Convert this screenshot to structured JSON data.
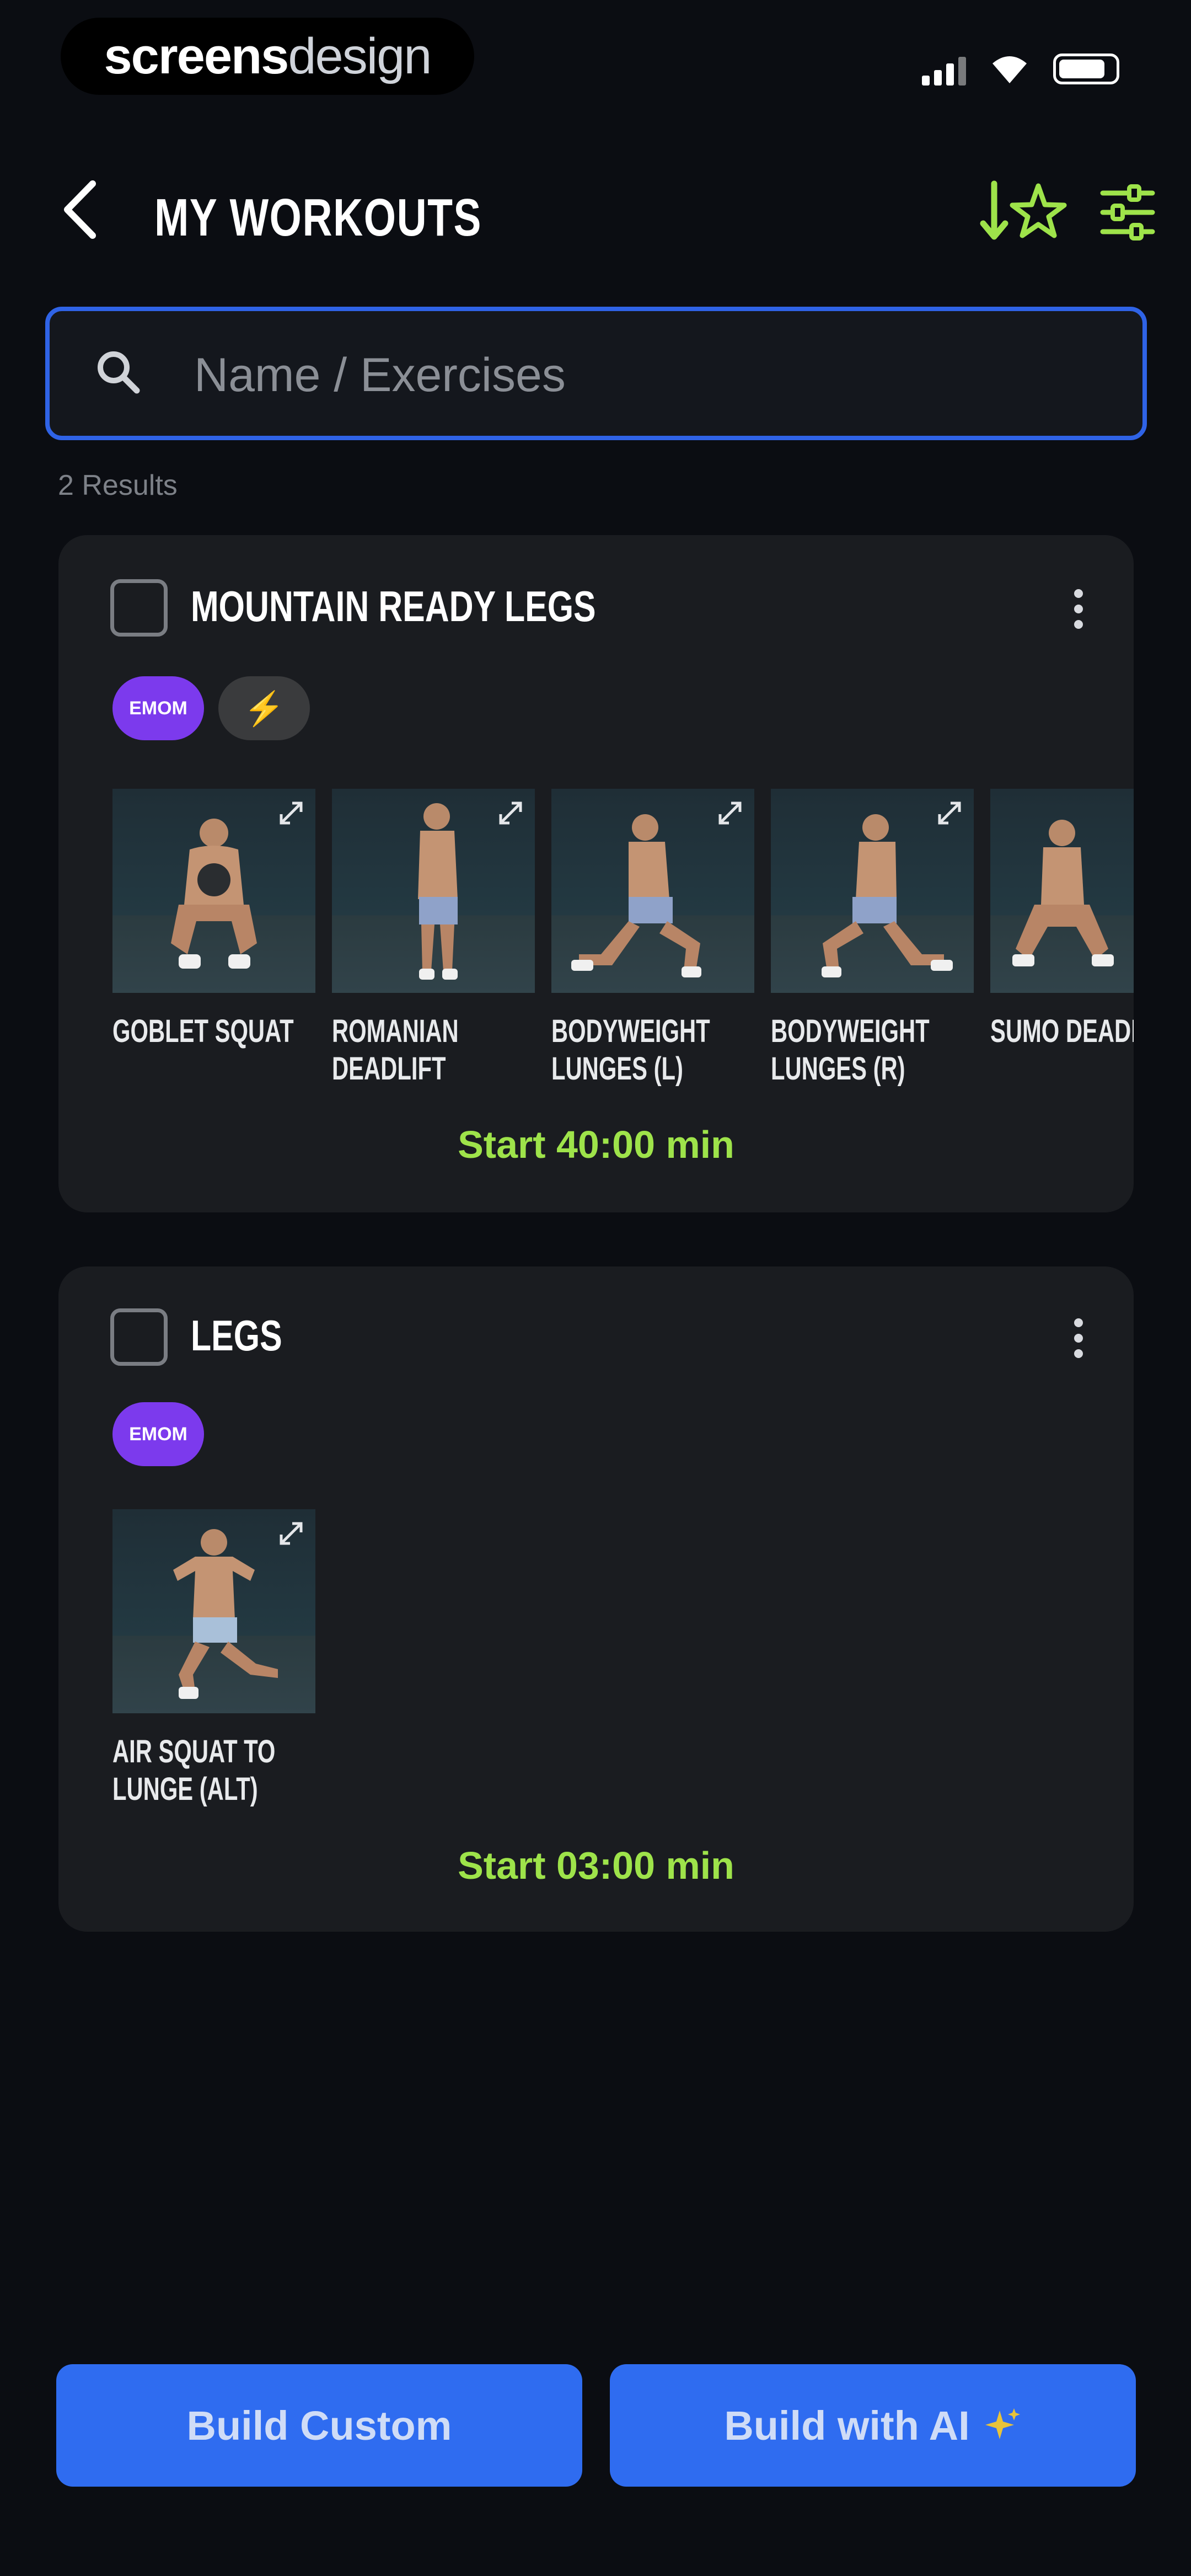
{
  "status_bar": {
    "brand_bold": "screens",
    "brand_light": "design"
  },
  "header": {
    "title": "MY WORKOUTS",
    "accent_color": "#9ee34a"
  },
  "search": {
    "placeholder": "Name / Exercises",
    "value": "",
    "border_color": "#2f63e6"
  },
  "results": {
    "count_text": "2 Results"
  },
  "workouts": [
    {
      "title": "MOUNTAIN READY LEGS",
      "tags": [
        "EMOM",
        "⚡"
      ],
      "exercises": [
        "GOBLET SQUAT",
        "ROMANIAN\nDEADLIFT",
        "BODYWEIGHT\nLUNGES (L)",
        "BODYWEIGHT\nLUNGES (R)",
        "SUMO DEADL"
      ],
      "start_label": "Start 40:00 min"
    },
    {
      "title": "LEGS",
      "tags": [
        "EMOM"
      ],
      "exercises": [
        "AIR SQUAT TO\nLUNGE (ALT)"
      ],
      "start_label": "Start 03:00 min"
    }
  ],
  "actions": {
    "build_custom": "Build Custom",
    "build_ai": "Build with AI",
    "button_color": "#2f6cf0"
  }
}
